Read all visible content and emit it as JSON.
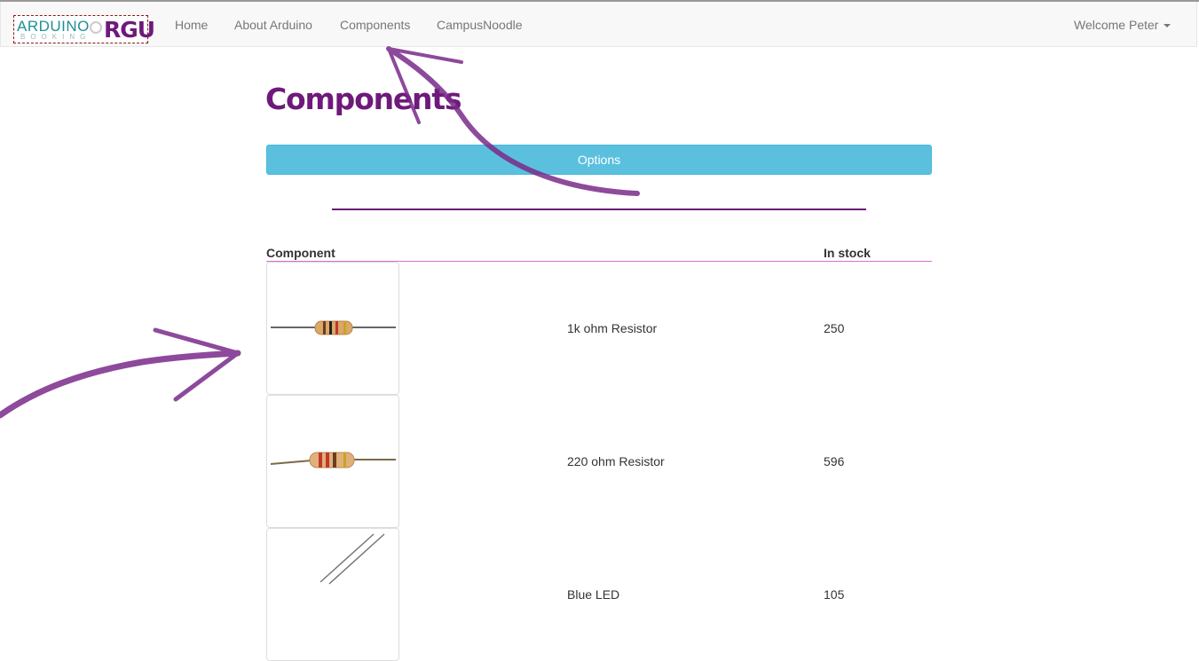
{
  "navbar": {
    "brand": {
      "word1": "ARDUINO",
      "word2": "BOOKING",
      "word3": "RGU"
    },
    "items": [
      {
        "label": "Home"
      },
      {
        "label": "About Arduino"
      },
      {
        "label": "Components"
      },
      {
        "label": "CampusNoodle"
      }
    ],
    "user_menu": "Welcome Peter"
  },
  "page": {
    "title": "Components",
    "options_button": "Options"
  },
  "table": {
    "headers": {
      "component": "Component",
      "stock": "In stock"
    },
    "rows": [
      {
        "name": "1k ohm Resistor",
        "stock": "250",
        "image": "resistor-1k"
      },
      {
        "name": "220 ohm Resistor",
        "stock": "596",
        "image": "resistor-220"
      },
      {
        "name": "Blue LED",
        "stock": "105",
        "image": "blue-led"
      }
    ]
  },
  "colors": {
    "brand_purple": "#6e1a7a",
    "options_button": "#5bc0de",
    "header_rule": "#d96fd2",
    "annotation_arrow": "#7a2a8a"
  }
}
